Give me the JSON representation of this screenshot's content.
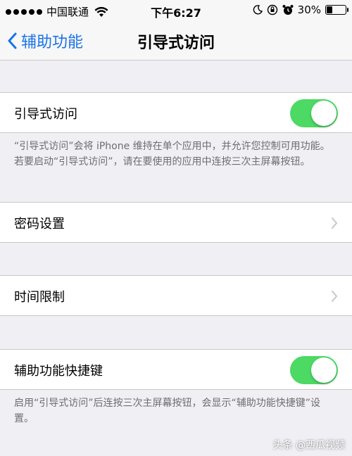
{
  "status_bar": {
    "carrier": "中国联通",
    "time": "下午6:27",
    "battery_text": "30%",
    "battery_level": 0.3,
    "icons": [
      "signal-dots",
      "wifi-icon",
      "moon-icon",
      "rotation-lock-icon",
      "alarm-icon",
      "battery-icon"
    ]
  },
  "nav": {
    "back_label": "辅助功能",
    "title": "引导式访问"
  },
  "guided_access": {
    "label": "引导式访问",
    "enabled": true,
    "note": "“引导式访问”会将 iPhone 维持在单个应用中，并允许您控制可用功能。若要启动“引导式访问”，请在要使用的应用中连按三次主屏幕按钮。"
  },
  "passcode": {
    "label": "密码设置"
  },
  "time_limit": {
    "label": "时间限制"
  },
  "shortcut": {
    "label": "辅助功能快捷键",
    "enabled": true,
    "note": "启用“引导式访问”后连按三次主屏幕按钮，会显示“辅助功能快捷键”设置。"
  },
  "watermark": "头条 @西瓜视频",
  "colors": {
    "accent": "#1a73e8",
    "toggle_on": "#4cd964",
    "background": "#efeff4"
  }
}
